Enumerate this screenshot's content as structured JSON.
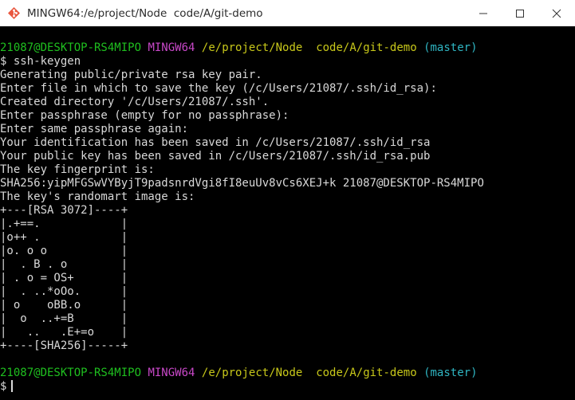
{
  "window": {
    "title": "MINGW64:/e/project/Node  code/A/git-demo",
    "colors": {
      "background": "#000000",
      "titlebar": "#ffffff",
      "text": "#d9d9d9",
      "user_host": "#1fbf1f",
      "system": "#c848c8",
      "path": "#c8c81a",
      "branch": "#2fb5c2"
    },
    "controls": {
      "minimize_icon": "minimize-icon",
      "maximize_icon": "maximize-icon",
      "close_icon": "close-icon"
    }
  },
  "terminal": {
    "prompt1": {
      "user_host": "21087@DESKTOP-RS4MIPO",
      "system": "MINGW64",
      "path": "/e/project/Node  code/A/git-demo",
      "branch": "(master)"
    },
    "command": "$ ssh-keygen",
    "output": [
      "Generating public/private rsa key pair.",
      "Enter file in which to save the key (/c/Users/21087/.ssh/id_rsa):",
      "Created directory '/c/Users/21087/.ssh'.",
      "Enter passphrase (empty for no passphrase):",
      "Enter same passphrase again:",
      "Your identification has been saved in /c/Users/21087/.ssh/id_rsa",
      "Your public key has been saved in /c/Users/21087/.ssh/id_rsa.pub",
      "The key fingerprint is:",
      "SHA256:yipMFGSwVYByjT9padsnrdVgi8fI8euUv8vCs6XEJ+k 21087@DESKTOP-RS4MIPO",
      "The key's randomart image is:",
      "+---[RSA 3072]----+",
      "|.+==.            |",
      "|o++ .            |",
      "|o. o o           |",
      "|  . B . o        |",
      "| . o = OS+       |",
      "|  . ..*oOo.      |",
      "| o    oBB.o      |",
      "|  o  ..+=B       |",
      "|   ..   .E+=o    |",
      "+----[SHA256]-----+"
    ],
    "prompt2": {
      "user_host": "21087@DESKTOP-RS4MIPO",
      "system": "MINGW64",
      "path": "/e/project/Node  code/A/git-demo",
      "branch": "(master)"
    },
    "input_prompt": "$"
  }
}
